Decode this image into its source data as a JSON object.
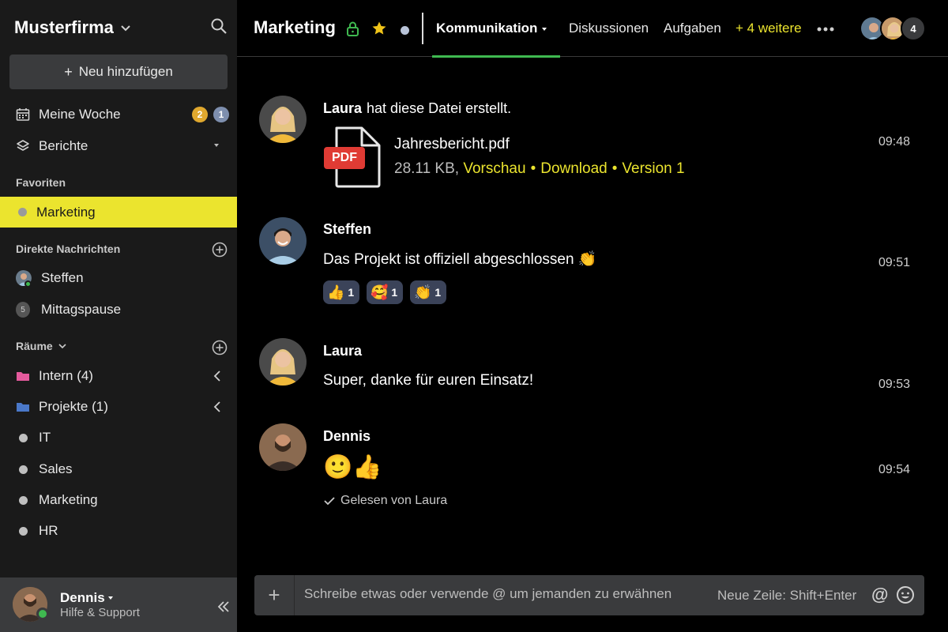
{
  "workspace": {
    "name": "Musterfirma"
  },
  "sidebar": {
    "new_button": "Neu hinzufügen",
    "meine_woche": {
      "label": "Meine Woche",
      "badge_yellow": "2",
      "badge_blue": "1"
    },
    "berichte": "Berichte",
    "favoriten_header": "Favoriten",
    "favoriten": [
      {
        "label": "Marketing"
      }
    ],
    "dm_header": "Direkte Nachrichten",
    "dms": [
      {
        "label": "Steffen"
      },
      {
        "label": "Mittagspause",
        "count": "5"
      }
    ],
    "rooms_header": "Räume",
    "rooms": [
      {
        "label": "Intern (4)"
      },
      {
        "label": "Projekte (1)"
      },
      {
        "label": "IT"
      },
      {
        "label": "Sales"
      },
      {
        "label": "Marketing"
      },
      {
        "label": "HR"
      }
    ]
  },
  "user": {
    "name": "Dennis",
    "status": "Hilfe & Support"
  },
  "header": {
    "title": "Marketing",
    "tabs": [
      "Kommunikation",
      "Diskussionen",
      "Aufgaben"
    ],
    "more_tabs": "+ 4 weitere",
    "member_count": "4"
  },
  "messages": [
    {
      "author": "Laura",
      "system_text": "hat diese Datei erstellt.",
      "file": {
        "name": "Jahresbericht.pdf",
        "size": "28.11 KB,",
        "preview": "Vorschau",
        "download": "Download",
        "version": "Version 1",
        "badge": "PDF"
      },
      "time": "09:48"
    },
    {
      "author": "Steffen",
      "text": "Das Projekt ist offiziell abgeschlossen 👏",
      "reactions": [
        {
          "emoji": "👍",
          "count": "1"
        },
        {
          "emoji": "🥰",
          "count": "1"
        },
        {
          "emoji": "👏",
          "count": "1"
        }
      ],
      "time": "09:51"
    },
    {
      "author": "Laura",
      "text": "Super, danke für euren Einsatz!",
      "time": "09:53"
    },
    {
      "author": "Dennis",
      "text": "🙂👍",
      "read_by": "Gelesen von Laura",
      "time": "09:54"
    }
  ],
  "composer": {
    "placeholder": "Schreibe etwas oder verwende @ um jemanden zu erwähnen",
    "hint": "Neue Zeile: Shift+Enter",
    "at": "@"
  },
  "colors": {
    "accent_yellow": "#ebe42e",
    "active_tab": "#3fb950",
    "sidebar_bg": "#1a1a1a"
  }
}
